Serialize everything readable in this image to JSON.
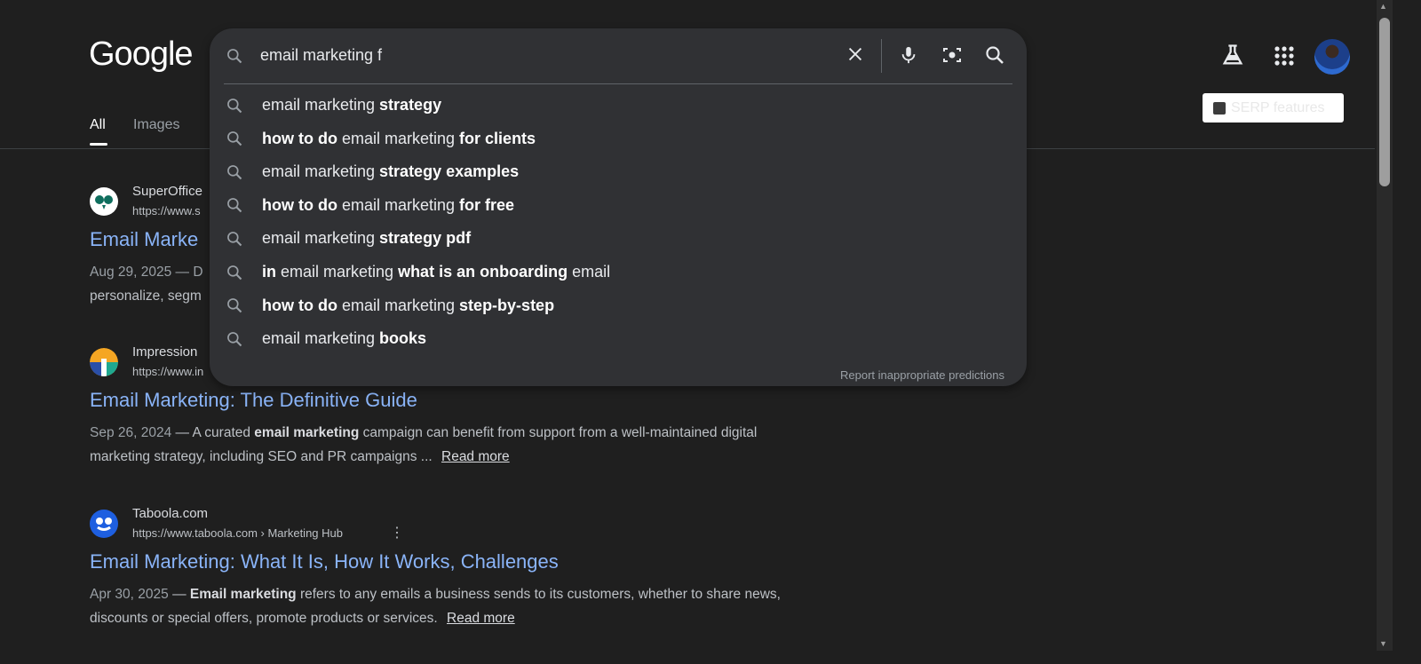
{
  "header": {
    "logo": "Google",
    "tabs": [
      "All",
      "Images"
    ],
    "serp_features": "SERP features"
  },
  "search": {
    "query": "email marketing f",
    "report": "Report inappropriate predictions",
    "suggestions": [
      [
        [
          "email marketing ",
          0
        ],
        [
          "strategy",
          1
        ]
      ],
      [
        [
          "how to do",
          1
        ],
        [
          " email marketing ",
          0
        ],
        [
          "for clients",
          1
        ]
      ],
      [
        [
          "email marketing ",
          0
        ],
        [
          "strategy examples",
          1
        ]
      ],
      [
        [
          "how to do",
          1
        ],
        [
          " email marketing ",
          0
        ],
        [
          "for free",
          1
        ]
      ],
      [
        [
          "email marketing ",
          0
        ],
        [
          "strategy pdf",
          1
        ]
      ],
      [
        [
          "in",
          1
        ],
        [
          " email marketing ",
          0
        ],
        [
          "what is an onboarding",
          1
        ],
        [
          " email",
          0
        ]
      ],
      [
        [
          "how to do",
          1
        ],
        [
          " email marketing ",
          0
        ],
        [
          "step-by-step",
          1
        ]
      ],
      [
        [
          "email marketing ",
          0
        ],
        [
          "books",
          1
        ]
      ]
    ]
  },
  "results": [
    {
      "site": "SuperOffice",
      "url": "https://www.s",
      "title": "Email Marke",
      "date": "Aug 29, 2025 — D",
      "snippet_line2": "personalize, segm"
    },
    {
      "site": "Impression",
      "url": "https://www.in",
      "title": "Email Marketing: The Definitive Guide",
      "date": "Sep 26, 2024",
      "pre": "A curated ",
      "bold": "email marketing",
      "post": " campaign can benefit from support from a well-maintained digital marketing strategy, including SEO and PR campaigns ...",
      "read_more": "Read more"
    },
    {
      "site": "Taboola.com",
      "url": "https://www.taboola.com › Marketing Hub",
      "title": "Email Marketing: What It Is, How It Works, Challenges",
      "date": "Apr 30, 2025",
      "pre": "",
      "bold": "Email marketing",
      "post": " refers to any emails a business sends to its customers, whether to share news, discounts or special offers, promote products or services.",
      "read_more": "Read more"
    }
  ],
  "colors": {
    "background": "#1f1f1f",
    "dropdown": "#303134",
    "link": "#8ab4f8"
  }
}
